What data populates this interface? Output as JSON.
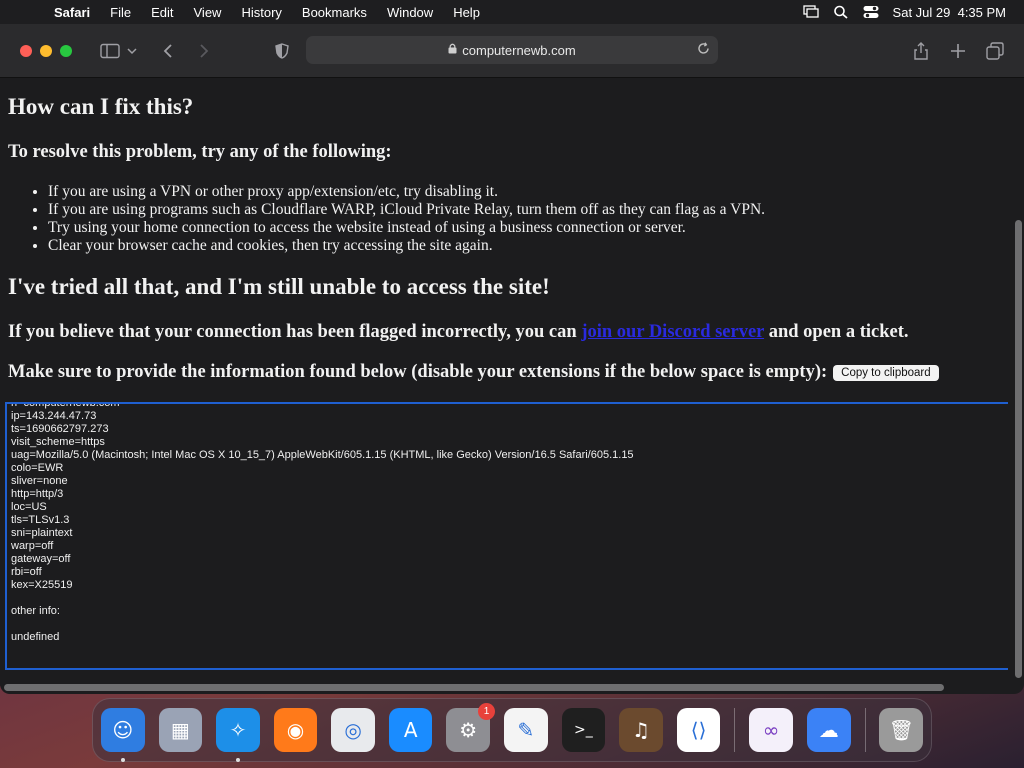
{
  "menubar": {
    "apple": "",
    "app_name": "Safari",
    "items": [
      "File",
      "Edit",
      "View",
      "History",
      "Bookmarks",
      "Window",
      "Help"
    ],
    "datetime": "Sat Jul 29  4:35 PM"
  },
  "browser": {
    "url": "computernewb.com"
  },
  "page": {
    "heading_fix": "How can I fix this?",
    "heading_resolve": "To resolve this problem, try any of the following:",
    "tips": [
      "If you are using a VPN or other proxy app/extension/etc, try disabling it.",
      "If you are using programs such as Cloudflare WARP, iCloud Private Relay, turn them off as they can flag as a VPN.",
      "Try using your home connection to access the website instead of using a business connection or server.",
      "Clear your browser cache and cookies, then try accessing the site again."
    ],
    "heading_tried": "I've tried all that, and I'm still unable to access the site!",
    "flagged_prefix": "If you believe that your connection has been flagged incorrectly, you can ",
    "flagged_link": "join our Discord server",
    "flagged_suffix": " and open a ticket.",
    "provide_info": "Make sure to provide the information found below (disable your extensions if the below space is empty):",
    "copy_button": "Copy to clipboard",
    "info_lines": [
      "h=computernewb.com",
      "ip=143.244.47.73",
      "ts=1690662797.273",
      "visit_scheme=https",
      "uag=Mozilla/5.0 (Macintosh; Intel Mac OS X 10_15_7) AppleWebKit/605.1.15 (KHTML, like Gecko) Version/16.5 Safari/605.1.15",
      "colo=EWR",
      "sliver=none",
      "http=http/3",
      "loc=US",
      "tls=TLSv1.3",
      "sni=plaintext",
      "warp=off",
      "gateway=off",
      "rbi=off",
      "kex=X25519",
      "",
      "other info:",
      "",
      "undefined"
    ]
  },
  "dock": {
    "items": [
      {
        "name": "finder-icon",
        "color": "#2f7de1"
      },
      {
        "name": "launchpad-icon",
        "color": "#9aa3b5"
      },
      {
        "name": "safari-icon",
        "color": "#1d8fe8"
      },
      {
        "name": "firefox-icon",
        "color": "#ff7a1a"
      },
      {
        "name": "chrome-icon",
        "color": "#e8eaed"
      },
      {
        "name": "app-store-icon",
        "color": "#1a8cff"
      },
      {
        "name": "system-settings-icon",
        "color": "#8e8e93",
        "badge": "1"
      },
      {
        "name": "textedit-icon",
        "color": "#f4f4f4"
      },
      {
        "name": "terminal-icon",
        "color": "#1f1f1f"
      },
      {
        "name": "garageband-icon",
        "color": "#6b4a2e"
      },
      {
        "name": "vscode-icon",
        "color": "#ffffff"
      },
      {
        "name": "visual-studio-icon",
        "color": "#f4f0fa"
      },
      {
        "name": "weather-icon",
        "color": "#3b82f6"
      },
      {
        "name": "trash-icon",
        "color": "#9a9a9a"
      }
    ]
  }
}
